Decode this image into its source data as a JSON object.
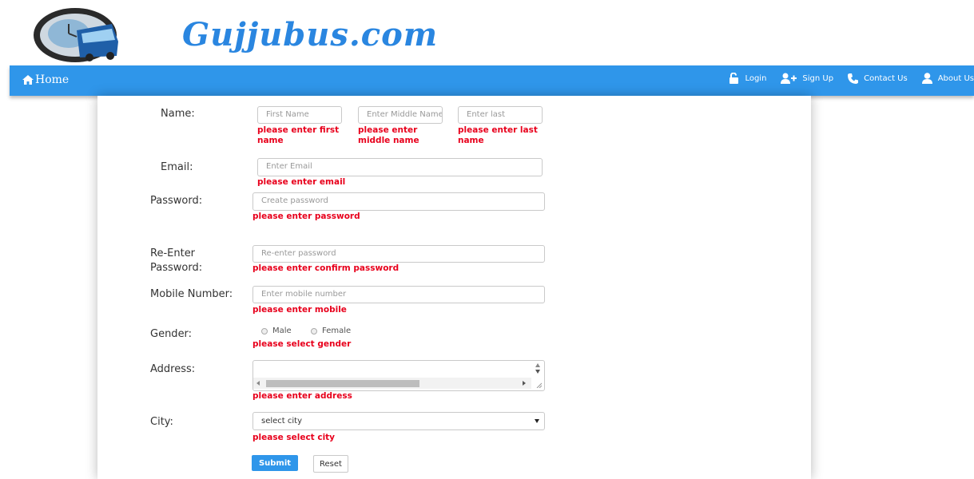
{
  "header": {
    "site_title": "Gujjubus.com"
  },
  "nav": {
    "home": "Home",
    "items": [
      {
        "label": "Login",
        "icon": "unlock-icon"
      },
      {
        "label": "Sign Up",
        "icon": "add-user-icon"
      },
      {
        "label": "Contact Us",
        "icon": "phone-icon"
      },
      {
        "label": "About Us",
        "icon": "user-icon"
      }
    ]
  },
  "form": {
    "name": {
      "label": "Name:",
      "first_placeholder": "First Name",
      "middle_placeholder": "Enter Middle Name",
      "last_placeholder": "Enter last",
      "first_error": "please enter first name",
      "middle_error": "please enter middle name",
      "last_error": "please enter last name"
    },
    "email": {
      "label": "Email:",
      "placeholder": "Enter Email",
      "error": "please enter email"
    },
    "password": {
      "label": "Password:",
      "placeholder": "Create password",
      "error": "please enter password"
    },
    "repassword": {
      "label_line1": "Re-Enter",
      "label_line2": "Password:",
      "placeholder": "Re-enter password",
      "error": "please enter confirm password"
    },
    "mobile": {
      "label": "Mobile Number:",
      "placeholder": "Enter mobile number",
      "error": "please enter mobile"
    },
    "gender": {
      "label": "Gender:",
      "options": [
        "Male",
        "Female"
      ],
      "error": "please select gender"
    },
    "address": {
      "label": "Address:",
      "error": "please enter address"
    },
    "city": {
      "label": "City:",
      "selected": "select city",
      "error": "please select city"
    },
    "submit_label": "Submit",
    "reset_label": "Reset"
  },
  "colors": {
    "nav_bg": "#2f96ea",
    "error": "#e8001c",
    "title": "#2a86e0"
  }
}
